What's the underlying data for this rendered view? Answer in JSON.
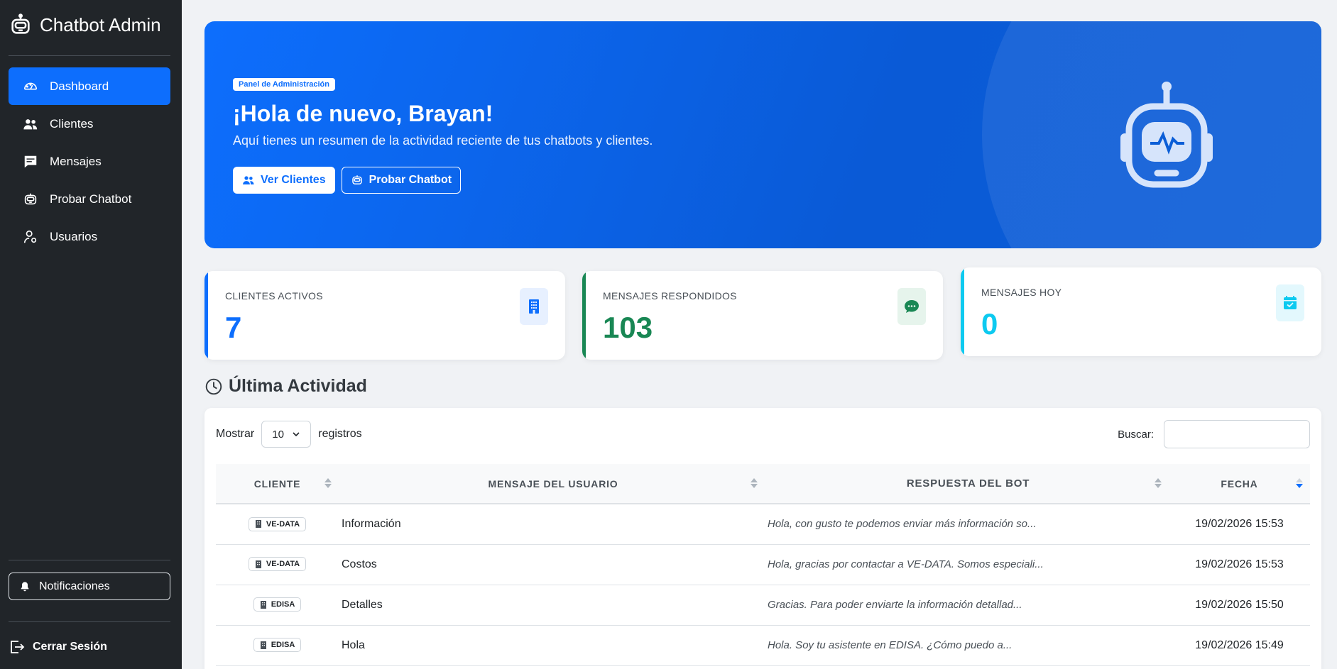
{
  "app": {
    "brand": "Chatbot Admin"
  },
  "sidebar": {
    "items": [
      {
        "label": "Dashboard",
        "icon": "dashboard-gauge-icon",
        "active": true
      },
      {
        "label": "Clientes",
        "icon": "people-icon",
        "active": false
      },
      {
        "label": "Mensajes",
        "icon": "chat-square-icon",
        "active": false
      },
      {
        "label": "Probar Chatbot",
        "icon": "robot-icon",
        "active": false
      },
      {
        "label": "Usuarios",
        "icon": "person-gear-icon",
        "active": false
      }
    ],
    "notifications_label": "Notificaciones",
    "logout_label": "Cerrar Sesión"
  },
  "hero": {
    "badge": "Panel de Administración",
    "title": "¡Hola de nuevo, Brayan!",
    "subtitle": "Aquí tienes un resumen de la actividad reciente de tus chatbots y clientes.",
    "btn_clients": "Ver Clientes",
    "btn_test": "Probar Chatbot"
  },
  "stats": [
    {
      "label": "CLIENTES ACTIVOS",
      "value": "7",
      "icon": "building-icon",
      "color": "#0d6efd"
    },
    {
      "label": "MENSAJES RESPONDIDOS",
      "value": "103",
      "icon": "chat-dots-icon",
      "color": "#198754"
    },
    {
      "label": "MENSAJES HOY",
      "value": "0",
      "icon": "calendar-check-icon",
      "color": "#0dcaf0"
    }
  ],
  "activity": {
    "title": "Última Actividad",
    "show_label": "Mostrar",
    "page_size": "10",
    "records_label": "registros",
    "search_label": "Buscar:",
    "search_value": "",
    "columns": [
      "CLIENTE",
      "MENSAJE DEL USUARIO",
      "RESPUESTA DEL BOT",
      "FECHA"
    ],
    "rows": [
      {
        "client": "VE-DATA",
        "message": "Información",
        "response": "Hola, con gusto te podemos enviar más información so...",
        "date": "19/02/2026 15:53"
      },
      {
        "client": "VE-DATA",
        "message": "Costos",
        "response": "Hola, gracias por contactar a VE-DATA. Somos especiali...",
        "date": "19/02/2026 15:53"
      },
      {
        "client": "EDISA",
        "message": "Detalles",
        "response": "Gracias. Para poder enviarte la información detallad...",
        "date": "19/02/2026 15:50"
      },
      {
        "client": "EDISA",
        "message": "Hola",
        "response": "Hola. Soy tu asistente en EDISA. ¿Cómo puedo a...",
        "date": "19/02/2026 15:49"
      }
    ]
  }
}
